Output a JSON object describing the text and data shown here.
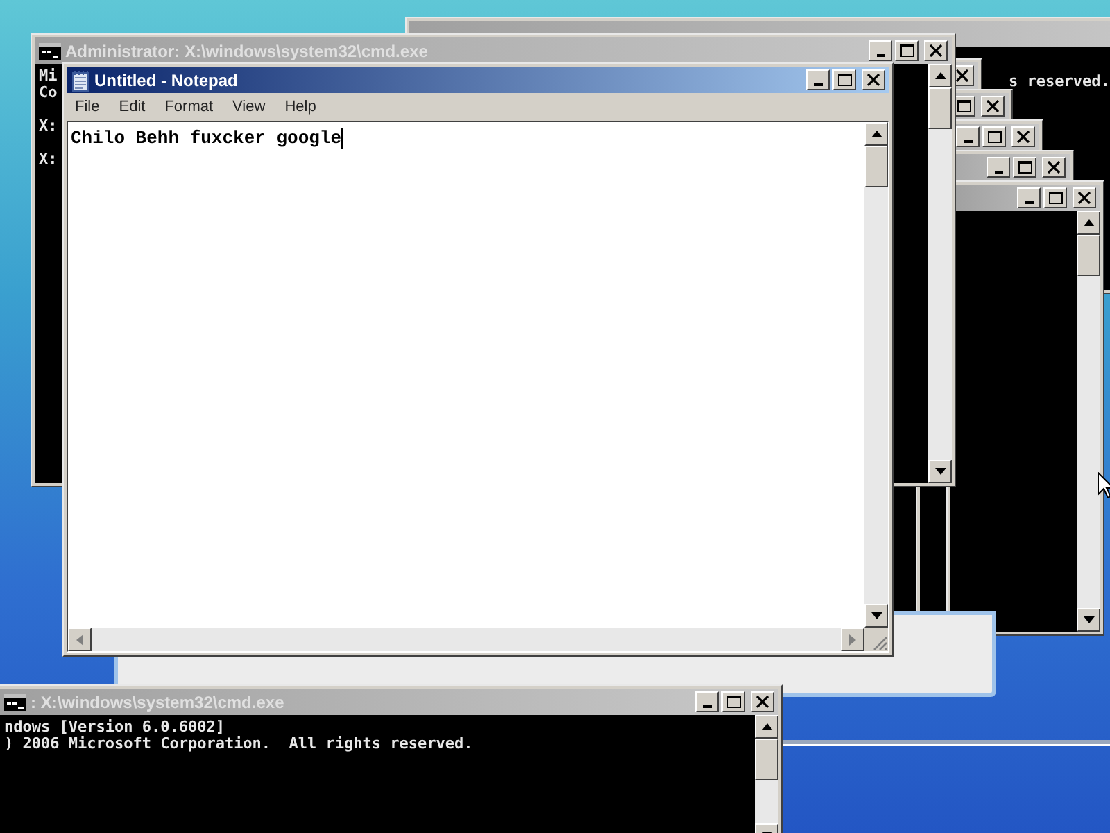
{
  "back_console": {
    "active": false,
    "lines": [
      {
        "kind": "gap",
        "text": "s reserved."
      }
    ]
  },
  "stacked_windows": [
    {
      "active": false
    },
    {
      "active": false
    },
    {
      "active": false
    },
    {
      "active": false
    },
    {
      "active": false
    }
  ],
  "console_window": {
    "title": "Administrator: X:\\windows\\system32\\cmd.exe",
    "active": false,
    "lines": [
      {
        "kind": "banner",
        "text": "Mi"
      },
      {
        "kind": "banner",
        "text": "Co"
      },
      {
        "kind": "gap",
        "text": "X:"
      },
      {
        "kind": "gap",
        "text": "X:"
      }
    ]
  },
  "notepad": {
    "title": "Untitled - Notepad",
    "active": true,
    "menu": [
      "File",
      "Edit",
      "Format",
      "View",
      "Help"
    ],
    "text": "Chilo Behh fuxcker google"
  },
  "bottom_console": {
    "title": ": X:\\windows\\system32\\cmd.exe",
    "active": false,
    "lines": [
      {
        "kind": "banner",
        "text": "ndows [Version 6.0.6002]"
      },
      {
        "kind": "banner",
        "text": ") 2006 Microsoft Corporation.  All rights reserved."
      }
    ]
  }
}
